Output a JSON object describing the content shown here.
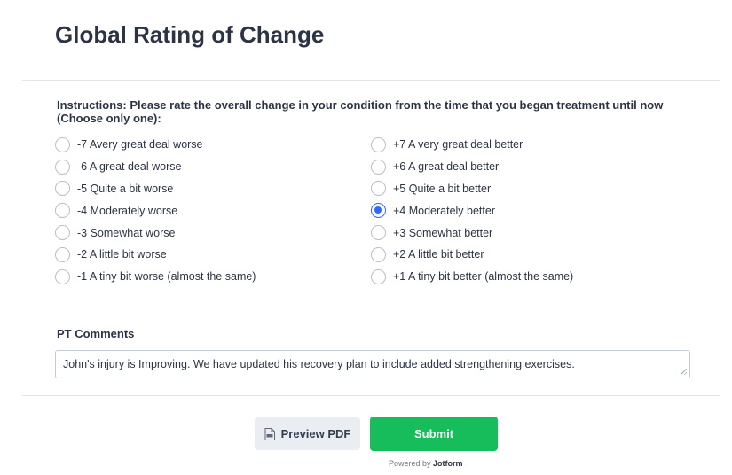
{
  "form": {
    "title": "Global Rating of Change",
    "instructions": "Instructions: Please rate the overall change in your condition from the time that you began treatment until now (Choose only one):",
    "options_left": [
      {
        "label": "-7 Avery great deal worse",
        "checked": false
      },
      {
        "label": "-6 A great deal worse",
        "checked": false
      },
      {
        "label": "-5 Quite a bit worse",
        "checked": false
      },
      {
        "label": "-4 Moderately worse",
        "checked": false
      },
      {
        "label": "-3 Somewhat worse",
        "checked": false
      },
      {
        "label": "-2 A little bit worse",
        "checked": false
      },
      {
        "label": "-1 A tiny bit worse (almost the same)",
        "checked": false
      }
    ],
    "options_right": [
      {
        "label": "+7 A very great deal better",
        "checked": false
      },
      {
        "label": "+6 A great deal better",
        "checked": false
      },
      {
        "label": "+5 Quite a bit better",
        "checked": false
      },
      {
        "label": "+4 Moderately better",
        "checked": true
      },
      {
        "label": "+3 Somewhat better",
        "checked": false
      },
      {
        "label": "+2 A little bit better",
        "checked": false
      },
      {
        "label": "+1 A tiny bit better (almost the same)",
        "checked": false
      }
    ],
    "comments_label": "PT Comments",
    "comments_value": "John's injury is Improving. We have updated his recovery plan to include added strengthening exercises."
  },
  "footer": {
    "preview_label": "Preview PDF",
    "submit_label": "Submit",
    "powered_prefix": "Powered by",
    "powered_brand": "Jotform"
  },
  "colors": {
    "accent": "#2e69ff",
    "submit": "#18bd5b",
    "preview_bg": "#eaedf2"
  }
}
